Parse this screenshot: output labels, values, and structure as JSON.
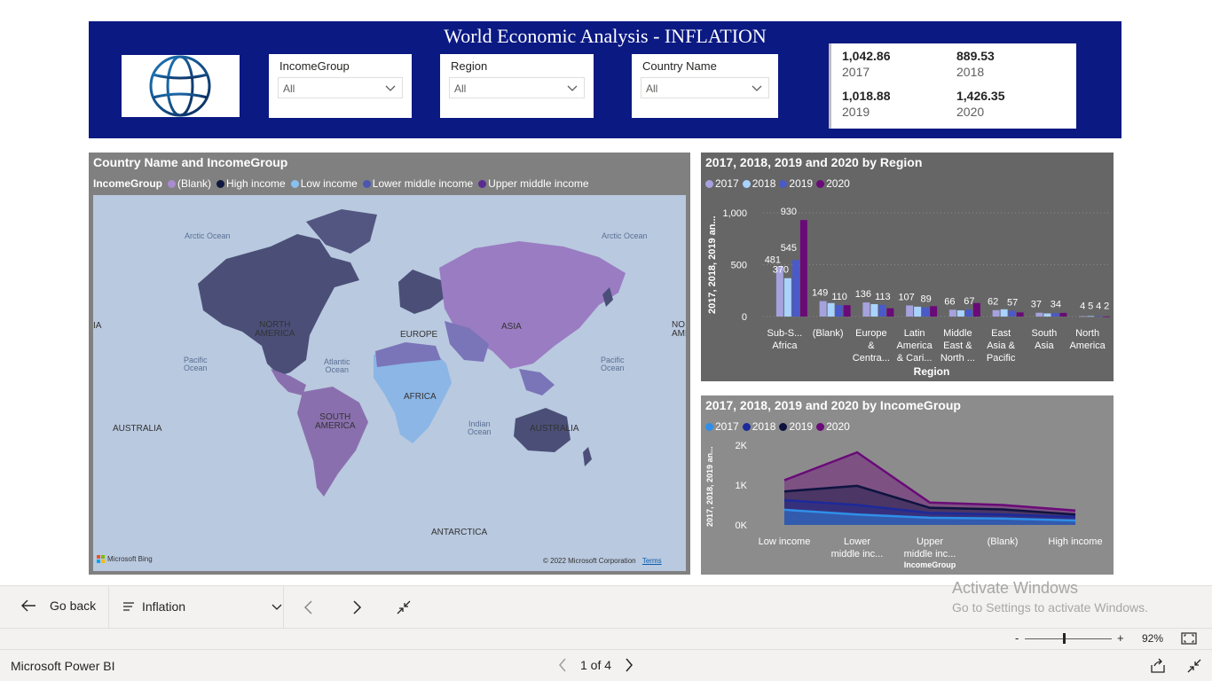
{
  "header": {
    "title": "World Economic Analysis - INFLATION",
    "logo": "world-bank-globe-icon",
    "bg_color": "#0b1983"
  },
  "slicers": [
    {
      "title": "IncomeGroup",
      "value": "All"
    },
    {
      "title": "Region",
      "value": "All"
    },
    {
      "title": "Country Name",
      "value": "All"
    }
  ],
  "kpis": [
    {
      "value": "1,042.86",
      "label": "2017"
    },
    {
      "value": "889.53",
      "label": "2018"
    },
    {
      "value": "1,018.88",
      "label": "2019"
    },
    {
      "value": "1,426.35",
      "label": "2020"
    }
  ],
  "map": {
    "title": "Country Name and IncomeGroup",
    "legend_title": "IncomeGroup",
    "legend": [
      {
        "name": "(Blank)",
        "color": "#a98bd0"
      },
      {
        "name": "High income",
        "color": "#101840"
      },
      {
        "name": "Low income",
        "color": "#88c0f0"
      },
      {
        "name": "Lower middle income",
        "color": "#4a56b0"
      },
      {
        "name": "Upper middle income",
        "color": "#5a2c90"
      }
    ],
    "labels": {
      "arctic_left": "Arctic\nOcean",
      "arctic_right": "Arctic\nOcean",
      "north_america": "NORTH\nAMERICA",
      "europe": "EUROPE",
      "asia": "ASIA",
      "pacific_left": "Pacific\nOcean",
      "atlantic": "Atlantic\nOcean",
      "pacific_right": "Pacific\nOcean",
      "africa": "AFRICA",
      "south_america": "SOUTH\nAMERICA",
      "indian": "Indian\nOcean",
      "australia_left": "AUSTRALIA",
      "australia": "AUSTRALIA",
      "antarctica": "ANTARCTICA",
      "edge_left": "IA",
      "edge_right": "NO\nAME"
    },
    "bing": "Microsoft Bing",
    "copyright": "© 2022 Microsoft Corporation",
    "terms": "Terms"
  },
  "bar_chart": {
    "title": "2017, 2018, 2019 and 2020 by Region",
    "legend": [
      {
        "name": "2017",
        "color": "#a5a2dd"
      },
      {
        "name": "2018",
        "color": "#a9d3ff"
      },
      {
        "name": "2019",
        "color": "#4a5ac8"
      },
      {
        "name": "2020",
        "color": "#6a0a78"
      }
    ],
    "ylabel": "2017, 2018, 2019 an...",
    "xlabel": "Region",
    "yticks": [
      "1,000",
      "500",
      "0"
    ]
  },
  "area_chart": {
    "title": "2017, 2018, 2019 and 2020 by IncomeGroup",
    "legend": [
      {
        "name": "2017",
        "color": "#2f8fe8"
      },
      {
        "name": "2018",
        "color": "#1c2a9a"
      },
      {
        "name": "2019",
        "color": "#0f1340"
      },
      {
        "name": "2020",
        "color": "#6a0a78"
      }
    ],
    "ylabel": "2017, 2018, 2019 an...",
    "xlabel": "IncomeGroup",
    "yticks": [
      "2K",
      "1K",
      "0K"
    ]
  },
  "chart_data": [
    {
      "type": "bar",
      "title": "2017, 2018, 2019 and 2020 by Region",
      "xlabel": "Region",
      "ylabel": "2017, 2018, 2019 an...",
      "ylim": [
        0,
        1000
      ],
      "categories": [
        "Sub-S... Africa",
        "(Blank)",
        "Europe & Centra...",
        "Latin America & Cari...",
        "Middle East & North ...",
        "East Asia & Pacific",
        "South Asia",
        "North America"
      ],
      "category_lines": [
        [
          "Sub-S...",
          "Africa"
        ],
        [
          "(Blank)"
        ],
        [
          "Europe",
          "&",
          "Centra..."
        ],
        [
          "Latin",
          "America",
          "& Cari..."
        ],
        [
          "Middle",
          "East &",
          "North ..."
        ],
        [
          "East",
          "Asia &",
          "Pacific"
        ],
        [
          "South",
          "Asia"
        ],
        [
          "North",
          "America"
        ]
      ],
      "series": [
        {
          "name": "2017",
          "values": [
            481,
            149,
            136,
            107,
            66,
            62,
            37,
            4
          ]
        },
        {
          "name": "2018",
          "values": [
            370,
            130,
            120,
            95,
            60,
            70,
            30,
            5
          ]
        },
        {
          "name": "2019",
          "values": [
            545,
            110,
            113,
            89,
            67,
            57,
            34,
            4
          ]
        },
        {
          "name": "2020",
          "values": [
            930,
            110,
            80,
            100,
            130,
            40,
            35,
            2
          ]
        }
      ],
      "data_labels": [
        [
          "481",
          "370",
          "545",
          "930"
        ],
        [
          "149",
          "110"
        ],
        [
          "136",
          "113"
        ],
        [
          "107",
          "89"
        ],
        [
          "66",
          "67"
        ],
        [
          "62",
          "57"
        ],
        [
          "37",
          "34"
        ],
        [
          "4",
          "5",
          "4",
          "2"
        ]
      ],
      "grid": true,
      "legend_position": "top-left"
    },
    {
      "type": "area",
      "title": "2017, 2018, 2019 and 2020 by IncomeGroup",
      "xlabel": "IncomeGroup",
      "ylabel": "2017, 2018, 2019 an...",
      "ylim": [
        0,
        2000
      ],
      "categories": [
        "Low income",
        "Lower middle inc...",
        "Upper middle inc...",
        "(Blank)",
        "High income"
      ],
      "category_lines": [
        [
          "Low income"
        ],
        [
          "Lower",
          "middle inc..."
        ],
        [
          "Upper",
          "middle inc..."
        ],
        [
          "(Blank)"
        ],
        [
          "High income"
        ]
      ],
      "series": [
        {
          "name": "2017",
          "values": [
            380,
            260,
            180,
            160,
            110
          ]
        },
        {
          "name": "2018",
          "values": [
            620,
            500,
            300,
            260,
            200
          ]
        },
        {
          "name": "2019",
          "values": [
            840,
            980,
            430,
            390,
            260
          ]
        },
        {
          "name": "2020",
          "values": [
            1120,
            1820,
            560,
            500,
            360
          ]
        }
      ],
      "grid": false,
      "legend_position": "top-left"
    }
  ],
  "navbar": {
    "back_label": "Go back",
    "page_select": "Inflation"
  },
  "activate": {
    "line1": "Activate Windows",
    "line2": "Go to Settings to activate Windows."
  },
  "zoom": {
    "minus": "-",
    "plus": "+",
    "level": "92%"
  },
  "status": {
    "brand": "Microsoft Power BI",
    "pager": "1 of 4"
  }
}
